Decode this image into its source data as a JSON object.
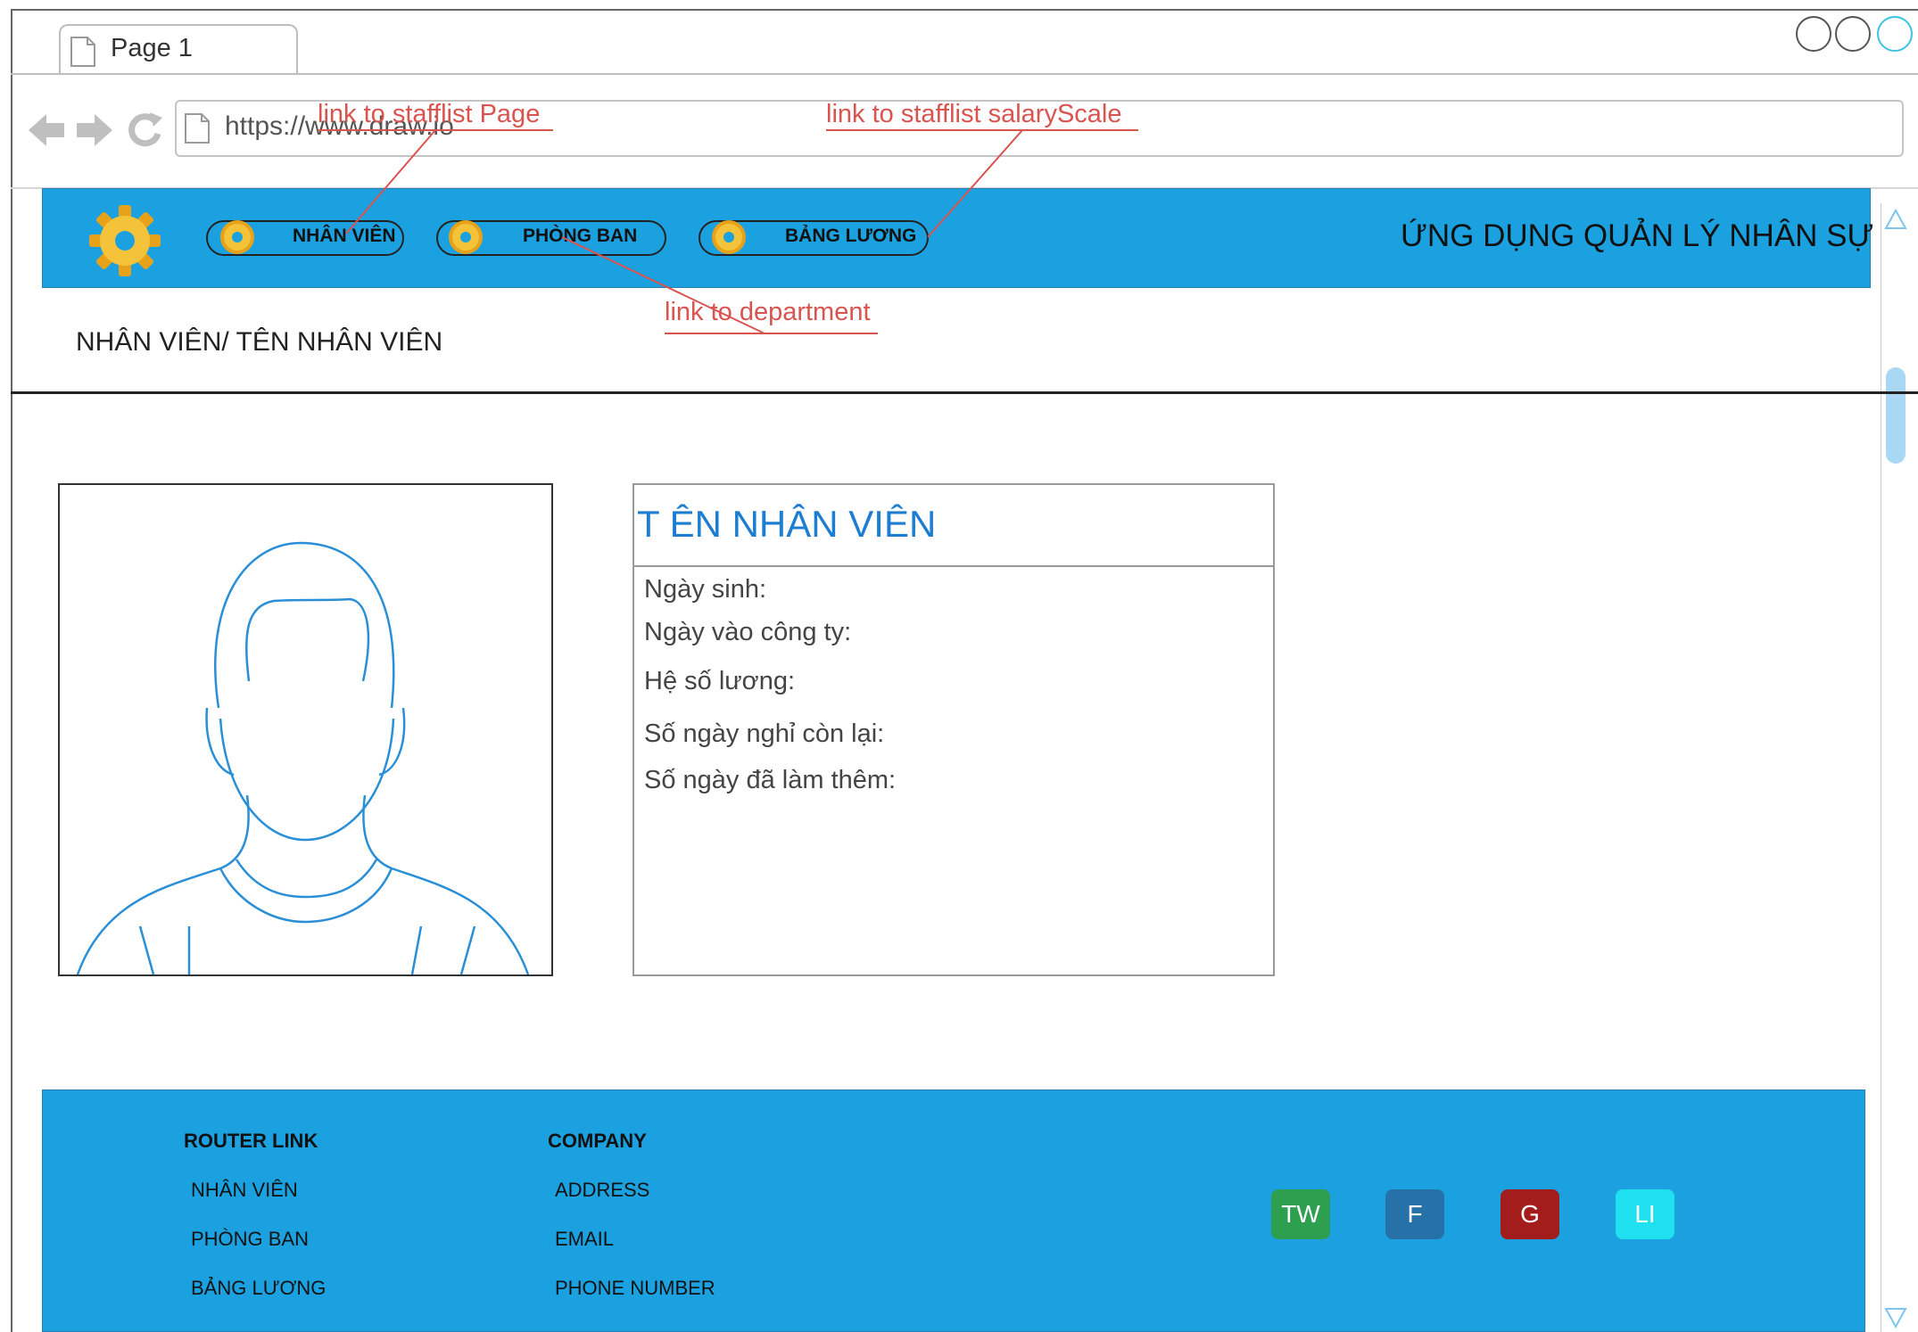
{
  "browser": {
    "tab_title": "Page 1",
    "url": "https://www.draw.io"
  },
  "header": {
    "nav": [
      {
        "label": "NHÂN VIÊN"
      },
      {
        "label": "PHÒNG BAN"
      },
      {
        "label": "BẢNG LƯƠNG"
      }
    ],
    "app_title": "ỨNG DỤNG QUẢN LÝ NHÂN SỰ"
  },
  "breadcrumb": "NHÂN VIÊN/ TÊN NHÂN VIÊN",
  "profile": {
    "name": "T ÊN NHÂN VIÊN",
    "fields": [
      "Ngày sinh:",
      "Ngày vào công ty:",
      "Hệ số lương:",
      "Số ngày nghỉ còn lại:",
      "Số ngày đã làm thêm:"
    ]
  },
  "annotations": {
    "staff": "link to stafflist Page",
    "salary": "link to stafflist salaryScale",
    "department": "link to department"
  },
  "footer": {
    "router_heading": "ROUTER LINK",
    "router_links": [
      "NHÂN VIÊN",
      "PHÒNG BAN",
      "BẢNG LƯƠNG"
    ],
    "company_heading": "COMPANY",
    "company_links": [
      "ADDRESS",
      "EMAIL",
      "PHONE NUMBER"
    ],
    "social": [
      {
        "label": "TW",
        "color": "#2e9e4f"
      },
      {
        "label": "F",
        "color": "#2672a8"
      },
      {
        "label": "G",
        "color": "#a31d1d"
      },
      {
        "label": "LI",
        "color": "#1ee0ee"
      }
    ]
  },
  "colors": {
    "header_bg": "#1ca1e0",
    "annotation": "#d9534f",
    "name_title": "#1c7dd1"
  }
}
